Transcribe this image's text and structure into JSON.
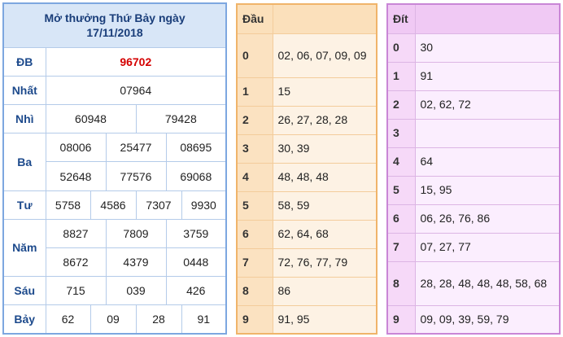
{
  "results": {
    "title_line1": "Mở thưởng Thứ Bảy ngày",
    "title_line2": "17/11/2018",
    "labels": {
      "db": "ĐB",
      "nhat": "Nhất",
      "nhi": "Nhì",
      "ba": "Ba",
      "tu": "Tư",
      "nam": "Năm",
      "sau": "Sáu",
      "bay": "Bảy"
    },
    "db": "96702",
    "nhat": "07964",
    "nhi": [
      "60948",
      "79428"
    ],
    "ba": [
      "08006",
      "25477",
      "08695",
      "52648",
      "77576",
      "69068"
    ],
    "tu": [
      "5758",
      "4586",
      "7307",
      "9930"
    ],
    "nam": [
      "8827",
      "7809",
      "3759",
      "8672",
      "4379",
      "0448"
    ],
    "sau": [
      "715",
      "039",
      "426"
    ],
    "bay": [
      "62",
      "09",
      "28",
      "91"
    ]
  },
  "dau": {
    "header": "Đầu",
    "rows": [
      {
        "key": "0",
        "value": "02, 06, 07, 09, 09"
      },
      {
        "key": "1",
        "value": "15"
      },
      {
        "key": "2",
        "value": "26, 27, 28, 28"
      },
      {
        "key": "3",
        "value": "30, 39"
      },
      {
        "key": "4",
        "value": "48, 48, 48"
      },
      {
        "key": "5",
        "value": "58, 59"
      },
      {
        "key": "6",
        "value": "62, 64, 68"
      },
      {
        "key": "7",
        "value": "72, 76, 77, 79"
      },
      {
        "key": "8",
        "value": "86"
      },
      {
        "key": "9",
        "value": "91, 95"
      }
    ]
  },
  "dit": {
    "header": "Đít",
    "rows": [
      {
        "key": "0",
        "value": "30"
      },
      {
        "key": "1",
        "value": "91"
      },
      {
        "key": "2",
        "value": "02, 62, 72"
      },
      {
        "key": "3",
        "value": ""
      },
      {
        "key": "4",
        "value": "64"
      },
      {
        "key": "5",
        "value": "15, 95"
      },
      {
        "key": "6",
        "value": "06, 26, 76, 86"
      },
      {
        "key": "7",
        "value": "07, 27, 77"
      },
      {
        "key": "8",
        "value": "28, 28, 48, 48, 48, 58, 68"
      },
      {
        "key": "9",
        "value": "09, 09, 39, 59, 79"
      }
    ]
  },
  "colors": {
    "results_border": "#7da7e0",
    "results_header_bg": "#d8e6f7",
    "db_value": "#d40000",
    "dau_border": "#f0b46a",
    "dau_bg": "#fdf2e4",
    "dit_border": "#c986d6",
    "dit_bg": "#fbeefe"
  }
}
